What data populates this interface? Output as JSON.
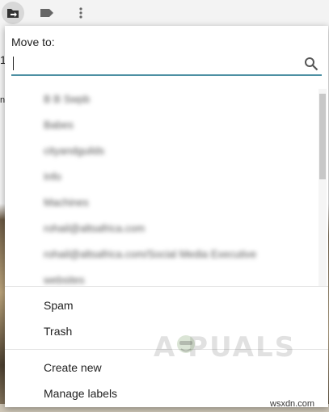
{
  "move_dialog": {
    "title": "Move to:",
    "search": {
      "value": "",
      "placeholder": ""
    },
    "labels": [
      "B B Swpb",
      "Babes",
      "cityandguilds",
      "Info",
      "Machines",
      "rohail@altsafrica.com",
      "rohail@altsafrica.com/Social Media Executive",
      "websites"
    ],
    "system_folders": [
      "Spam",
      "Trash"
    ],
    "actions": {
      "create_new": "Create new",
      "manage_labels": "Manage labels"
    }
  },
  "background": {
    "peek_1": "1",
    "peek_n": "n"
  },
  "watermark": {
    "text": "A  PUALS"
  },
  "source_label": "wsxdn.com",
  "colors": {
    "accent_underline": "#4d90a3",
    "scrollbar": "#c7c7c7"
  }
}
